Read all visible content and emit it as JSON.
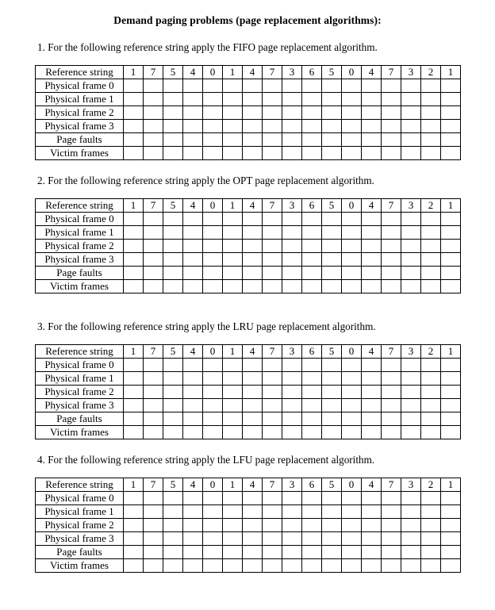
{
  "document": {
    "title": "Demand paging problems (page replacement algorithms):"
  },
  "table_labels": {
    "reference_string": "Reference string",
    "physical_frame_0": "Physical frame 0",
    "physical_frame_1": "Physical frame 1",
    "physical_frame_2": "Physical frame 2",
    "physical_frame_3": "Physical frame 3",
    "page_faults": "Page faults",
    "victim_frames": "Victim frames"
  },
  "reference_string": [
    1,
    7,
    5,
    4,
    0,
    1,
    4,
    7,
    3,
    6,
    5,
    0,
    4,
    7,
    3,
    2,
    1
  ],
  "problems": [
    {
      "number": "1.",
      "algorithm": "FIFO",
      "text": "1. For the following reference string apply the FIFO page replacement algorithm."
    },
    {
      "number": "2.",
      "algorithm": "OPT",
      "text": "2. For the following reference string apply the OPT page replacement algorithm."
    },
    {
      "number": "3.",
      "algorithm": "LRU",
      "text": "3. For the following reference string apply the LRU page replacement algorithm."
    },
    {
      "number": "4.",
      "algorithm": "LFU",
      "text": "4. For the following reference string apply the LFU page replacement algorithm."
    }
  ],
  "colors": {
    "text": "#000000",
    "border": "#000000",
    "background": "#ffffff"
  }
}
